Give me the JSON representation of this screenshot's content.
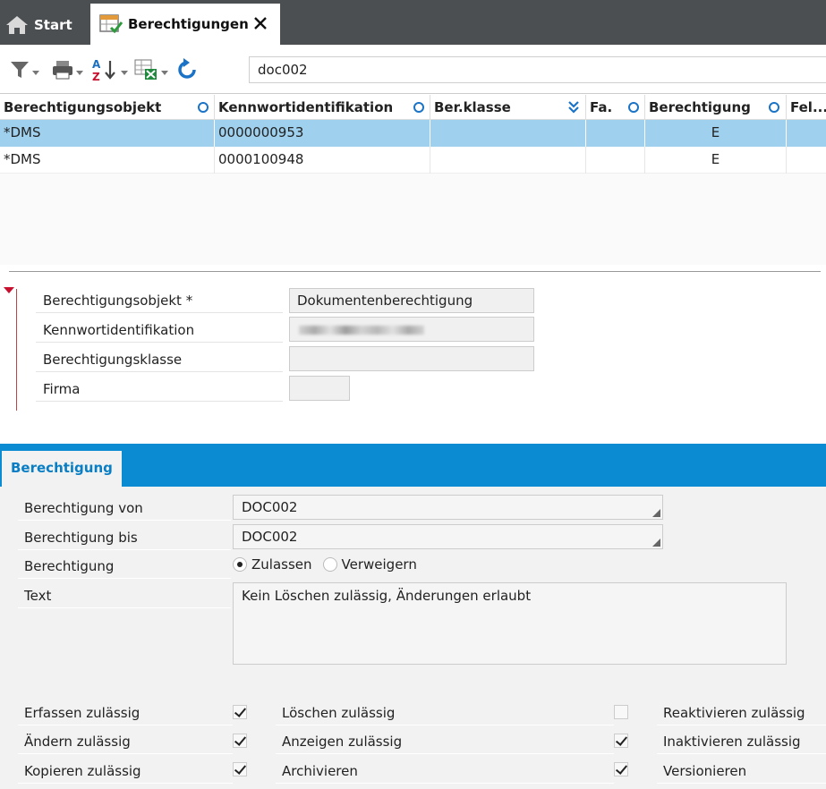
{
  "tabs": {
    "start_label": "Start",
    "active_label": "Berechtigungen"
  },
  "toolbar": {
    "search_value": "doc002"
  },
  "grid": {
    "columns": [
      "Berechtigungsobjekt",
      "Kennwortidentifikation",
      "Ber.klasse",
      "Fa.",
      "Berechtigung",
      "Fel..."
    ],
    "rows": [
      {
        "objekt": "*DMS",
        "kennwort": "0000000953",
        "klasse": "",
        "firma": "",
        "berechtigung": "E",
        "feld": ""
      },
      {
        "objekt": "*DMS",
        "kennwort": "0000100948",
        "klasse": "",
        "firma": "",
        "berechtigung": "E",
        "feld": ""
      }
    ]
  },
  "detail": {
    "objekt_label": "Berechtigungsobjekt *",
    "objekt_value": "Dokumentenberechtigung",
    "kennwort_label": "Kennwortidentifikation",
    "klasse_label": "Berechtigungsklasse",
    "firma_label": "Firma"
  },
  "section": {
    "tab_label": "Berechtigung",
    "von_label": "Berechtigung von",
    "von_value": "DOC002",
    "bis_label": "Berechtigung bis",
    "bis_value": "DOC002",
    "berechtigung_label": "Berechtigung",
    "radio_allow": "Zulassen",
    "radio_deny": "Verweigern",
    "text_label": "Text",
    "text_value": "Kein Löschen zulässig, Änderungen erlaubt"
  },
  "permissions": {
    "erfassen": {
      "label": "Erfassen zulässig",
      "checked": true
    },
    "aendern": {
      "label": "Ändern zulässig",
      "checked": true
    },
    "kopieren": {
      "label": "Kopieren zulässig",
      "checked": true
    },
    "loeschen": {
      "label": "Löschen zulässig",
      "checked": false
    },
    "anzeigen": {
      "label": "Anzeigen zulässig",
      "checked": true
    },
    "archivieren": {
      "label": "Archivieren",
      "checked": true
    },
    "reaktivieren": {
      "label": "Reaktivieren zulässig"
    },
    "inaktivieren": {
      "label": "Inaktivieren zulässig"
    },
    "versionieren": {
      "label": "Versionieren"
    }
  },
  "colors": {
    "accent": "#0a8bd2",
    "selected_row": "#9fd0ee",
    "tabbar": "#4b4f52"
  }
}
